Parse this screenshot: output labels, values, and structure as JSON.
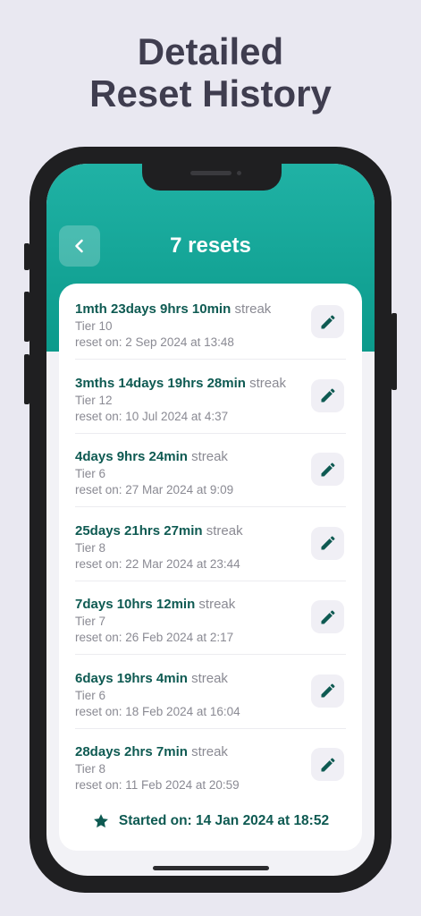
{
  "headline": {
    "line1": "Detailed",
    "line2": "Reset History"
  },
  "header": {
    "title": "7 resets",
    "back_icon": "chevron-left-icon"
  },
  "accent_color": "#0b9a8b",
  "entries": [
    {
      "streak": "1mth 23days 9hrs 10min",
      "suffix": "streak",
      "tier": "Tier 10",
      "reset": "reset on: 2 Sep 2024 at 13:48"
    },
    {
      "streak": "3mths 14days 19hrs 28min",
      "suffix": "streak",
      "tier": "Tier 12",
      "reset": "reset on: 10 Jul 2024 at 4:37"
    },
    {
      "streak": "4days 9hrs 24min",
      "suffix": "streak",
      "tier": "Tier 6",
      "reset": "reset on: 27 Mar 2024 at 9:09"
    },
    {
      "streak": "25days 21hrs 27min",
      "suffix": "streak",
      "tier": "Tier 8",
      "reset": "reset on: 22 Mar 2024 at 23:44"
    },
    {
      "streak": "7days 10hrs 12min",
      "suffix": "streak",
      "tier": "Tier 7",
      "reset": "reset on: 26 Feb 2024 at 2:17"
    },
    {
      "streak": "6days 19hrs 4min",
      "suffix": "streak",
      "tier": "Tier 6",
      "reset": "reset on: 18 Feb 2024 at 16:04"
    },
    {
      "streak": "28days 2hrs 7min",
      "suffix": "streak",
      "tier": "Tier 8",
      "reset": "reset on: 11 Feb 2024 at 20:59"
    }
  ],
  "footer": {
    "started": "Started on: 14 Jan 2024 at 18:52",
    "icon": "star-icon"
  }
}
